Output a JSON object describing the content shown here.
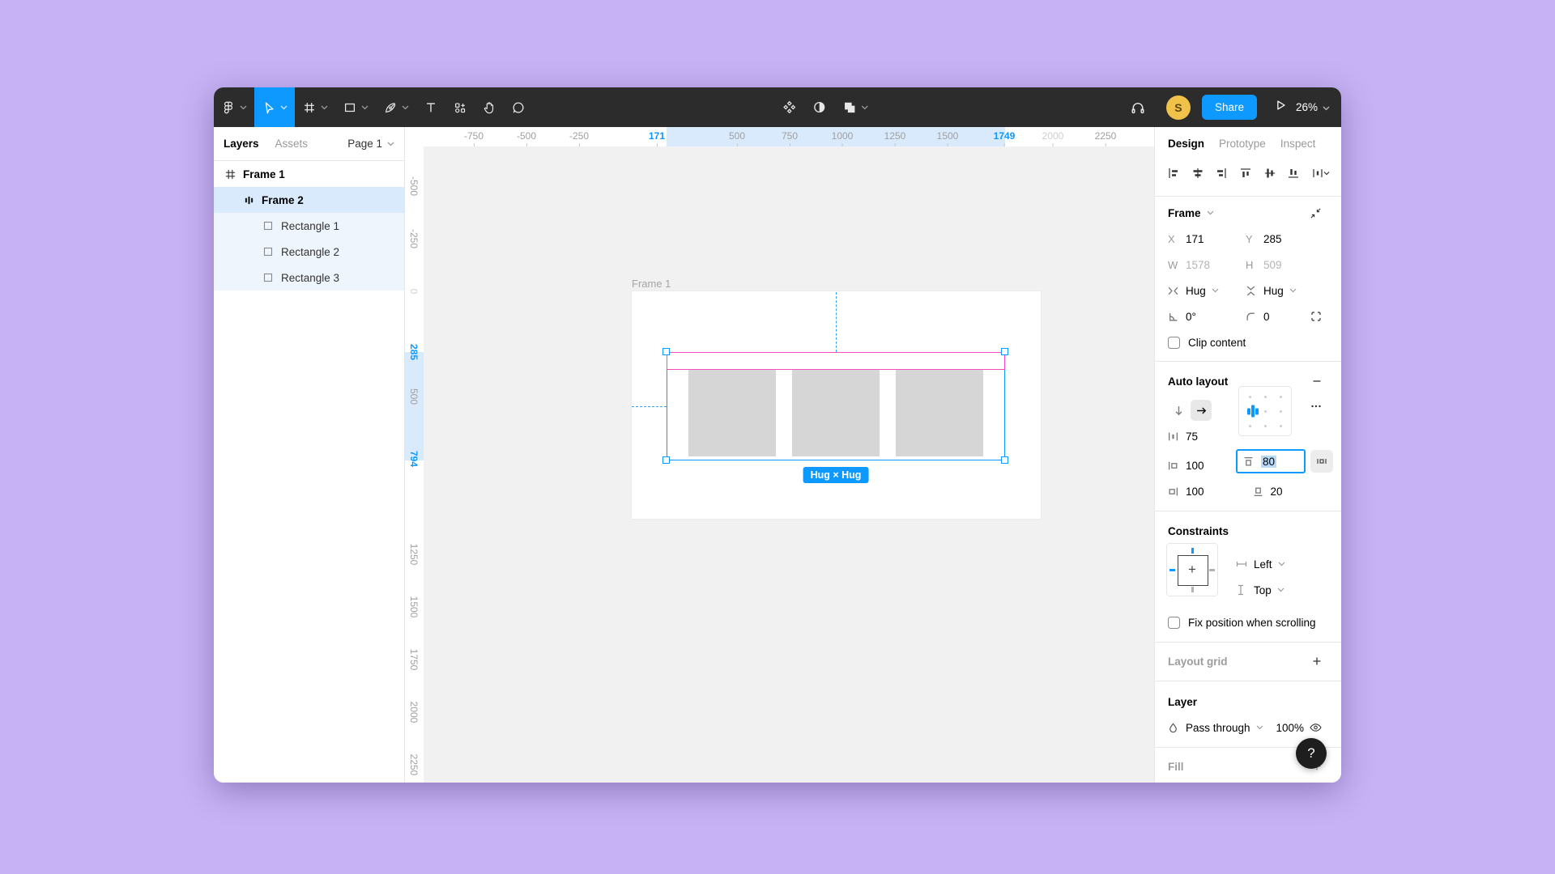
{
  "toolbar": {
    "share_label": "Share",
    "zoom_value": "26%",
    "avatar_initial": "S",
    "tools": [
      "figma-menu",
      "move-tool",
      "frame-tool",
      "shape-tool",
      "pen-tool",
      "text-tool",
      "resources-tool",
      "hand-tool",
      "comment-tool",
      "create-component",
      "use-as-mask",
      "boolean-groups",
      "audio",
      "present"
    ]
  },
  "sidebar": {
    "tab_layers": "Layers",
    "tab_assets": "Assets",
    "page_selector": "Page 1",
    "layers": [
      {
        "name": "Frame 1",
        "icon": "frame"
      },
      {
        "name": "Frame 2",
        "icon": "auto-layout"
      },
      {
        "name": "Rectangle 1",
        "icon": "rectangle"
      },
      {
        "name": "Rectangle 2",
        "icon": "rectangle"
      },
      {
        "name": "Rectangle 3",
        "icon": "rectangle"
      }
    ]
  },
  "canvas": {
    "frame_label": "Frame 1",
    "size_badge": "Hug × Hug",
    "h_ruler": [
      "-750",
      "-500",
      "-250",
      "171",
      "500",
      "750",
      "1000",
      "1250",
      "1500",
      "1749",
      "2000",
      "2250"
    ],
    "v_ruler": [
      "-500",
      "-250",
      "0",
      "285",
      "500",
      "794",
      "1250",
      "1500",
      "1750",
      "2000",
      "2250"
    ]
  },
  "inspector": {
    "tabs": {
      "design": "Design",
      "prototype": "Prototype",
      "inspect": "Inspect"
    },
    "frame": {
      "title": "Frame",
      "x_label": "X",
      "x": "171",
      "y_label": "Y",
      "y": "285",
      "w_label": "W",
      "w": "1578",
      "h_label": "H",
      "h": "509",
      "h_resizing": "Hug",
      "v_resizing": "Hug",
      "rotation": "0°",
      "corner_radius": "0",
      "clip_content": "Clip content"
    },
    "auto_layout": {
      "title": "Auto layout",
      "spacing": "75",
      "padding_left": "100",
      "padding_top": "80",
      "padding_right": "100",
      "padding_bottom": "20"
    },
    "constraints": {
      "title": "Constraints",
      "horizontal": "Left",
      "vertical": "Top",
      "fix_label": "Fix position when scrolling"
    },
    "layout_grid": {
      "title": "Layout grid"
    },
    "layer": {
      "title": "Layer",
      "blend_mode": "Pass through",
      "opacity": "100%"
    },
    "fill": {
      "title": "Fill"
    },
    "help_label": "?",
    "colors": {
      "accent": "#0d99ff",
      "padding_highlight": "#f44dbe",
      "selection_band": "#d9eafc"
    }
  }
}
